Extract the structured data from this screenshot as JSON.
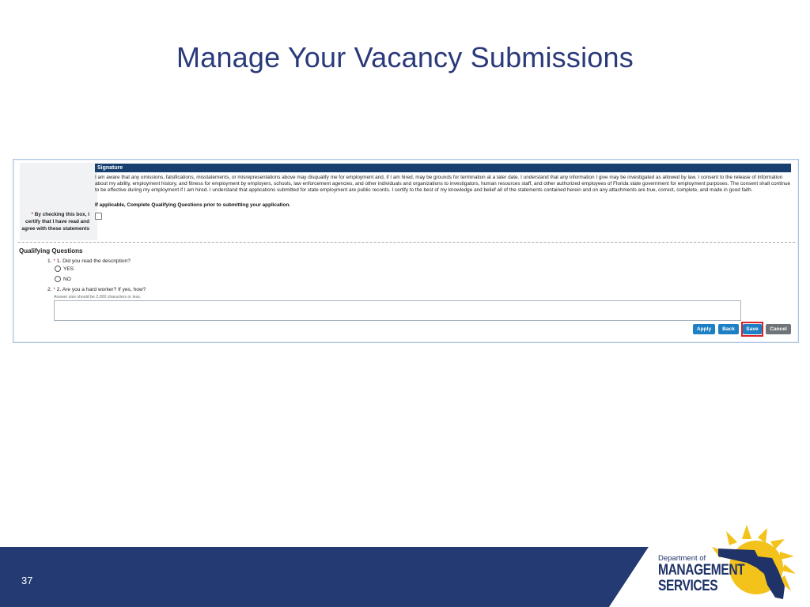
{
  "slide": {
    "title": "Manage Your Vacancy Submissions",
    "page_number": "37"
  },
  "signature": {
    "header": "Signature",
    "text": "I am aware that any omissions, falsifications, misstatements, or misrepresentations above may disqualify me for employment and, if I am hired, may be grounds for termination at a later date. I understand that any information I give may be investigated as allowed by law. I consent to the release of information about my ability, employment history, and fitness for employment by employers, schools, law enforcement agencies, and other individuals and organizations to investigators, human resources staff, and other authorized employees of Florida state government for employment purposes. The consent shall continue to be effective during my employment if I am hired. I understand that applications submitted for state employment are public records. I certify to the best of my knowledge and belief all of the statements contained herein and on any attachments are true, correct, complete, and made in good faith.",
    "note": "If applicable, Complete Qualifying Questions prior to submitting your application.",
    "required_mark": "*",
    "certify_label": "By checking this box, I certify that I have read and agree with these statements",
    "certify_checked": false
  },
  "qualifying": {
    "title": "Qualifying Questions",
    "q1_prefix": "1.",
    "q1_text": "1. Did you read the description?",
    "q1_options": [
      "YES",
      "NO"
    ],
    "q2_prefix": "2.",
    "q2_text": "2. Are you a hard worker? If yes, how?",
    "q2_hint": "Answer size should be 2,000 characters or less.",
    "q2_value": ""
  },
  "buttons": {
    "apply": "Apply",
    "back": "Back",
    "save": "Save",
    "cancel": "Cancel"
  },
  "logo": {
    "dept": "Department of",
    "line1": "MANAGEMENT",
    "line2": "SERVICES"
  },
  "colors": {
    "title": "#2a3a7a",
    "footer_navy": "#233a73",
    "header_bar": "#173f6f",
    "button_blue": "#1d7fc4",
    "button_gray": "#6f7479",
    "highlight_red": "#d9242a",
    "sun_yellow": "#f3c21b"
  }
}
